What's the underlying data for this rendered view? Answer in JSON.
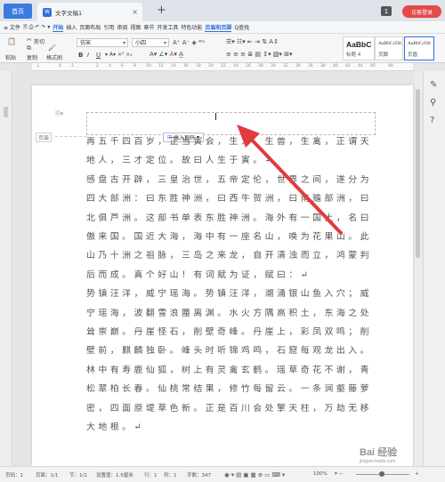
{
  "titlebar": {
    "home_label": "首页",
    "doc_tab_icon": "W",
    "doc_tab_title": "文字文稿1",
    "doc_tab_close": "×",
    "new_tab": "+",
    "badge": "1",
    "login_label": "访客登录"
  },
  "menu": {
    "items": [
      {
        "label": "≡ 文件"
      },
      {
        "label": "开始",
        "active": true
      },
      {
        "label": "插入"
      },
      {
        "label": "页面布局"
      },
      {
        "label": "引用"
      },
      {
        "label": "审阅"
      },
      {
        "label": "视图"
      },
      {
        "label": "章节"
      },
      {
        "label": "开发工具"
      },
      {
        "label": "特色功能"
      },
      {
        "label": "页眉和页脚",
        "active": true
      }
    ],
    "search": "Q查找"
  },
  "ribbon": {
    "paste": "粘贴",
    "cut": "剪切",
    "copy": "复制",
    "format_painter": "格式刷",
    "font_name": "仿宋",
    "font_size": "小四",
    "style_cards": [
      {
        "sample": "AaBbC",
        "label": "标题 4"
      },
      {
        "sample": "AaBbCcDd",
        "label": "页脚"
      },
      {
        "sample": "AaBbCcDd",
        "label": "页眉"
      }
    ]
  },
  "page": {
    "header_label": "页眉",
    "insert_pagenum": "插入页码",
    "paragraphs": [
      "再五千四百岁，正当寅会，生人，生兽，生禽，正谓天地人，三才定位。故曰人生于寅。↵",
      "感盘古开辟，三皇治世，五帝定伦，世界之间，遂分为四大部洲：曰东胜神洲，曰西牛贺洲，曰南赡部洲，曰北俱芦洲。这部书单表东胜神洲。海外有一国土，名曰傲来国。国近大海，海中有一座名山，唤为花果山。此山乃十洲之祖脉，三岛之来龙，自开清浊而立，鸿蒙判后而成。真个好山！有词赋为证，赋曰：↵",
      "势镇汪洋，威宁瑶海。势镇汪洋，潮涌银山鱼入穴；威宁瑶海，波翻雪浪蜃离渊。水火方隅高积土，东海之处耸崇巅。丹崖怪石，削壁奇峰。丹崖上，彩凤双鸣；削壁前，麒麟独卧。峰头时听锦鸡鸣，石窟每观龙出入。林中有寿鹿仙狐，树上有灵禽玄鹤。瑶草奇花不谢，青松翠柏长春。仙桃常结果，修竹每留云。一条涧壑藤萝密，四面原堤草色新。正是百川会处擎天柱，万劫无移大地根。↵"
    ]
  },
  "status": {
    "page": "页码：1",
    "pages": "页面：1/1",
    "section": "节：1/1",
    "setting": "设置值：1.5厘米",
    "row": "行：1",
    "col": "列：1",
    "words": "字数：347",
    "zoom": "100%"
  },
  "watermark": "Bai 经验",
  "watermark_sub": "jingyan.baidu.com"
}
